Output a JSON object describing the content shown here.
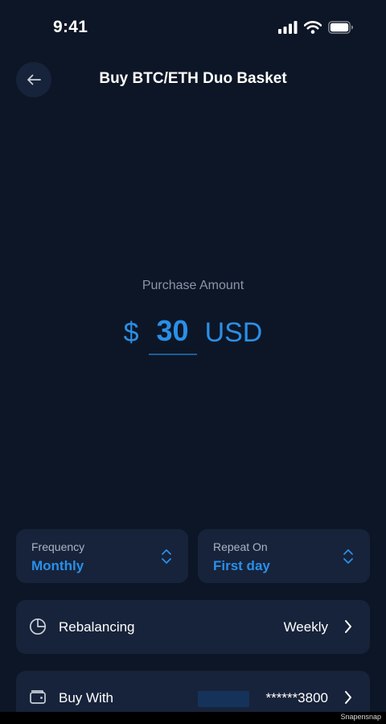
{
  "status_bar": {
    "time": "9:41",
    "icons": [
      "signal-icon",
      "wifi-icon",
      "battery-icon"
    ]
  },
  "header": {
    "back_icon": "arrow-left-icon",
    "title": "Buy BTC/ETH Duo Basket"
  },
  "purchase": {
    "label": "Purchase Amount",
    "currency_symbol": "$",
    "amount": "30",
    "currency_code": "USD"
  },
  "frequency": {
    "label": "Frequency",
    "value": "Monthly",
    "icon": "chevron-up-down-icon"
  },
  "repeat_on": {
    "label": "Repeat On",
    "value": "First day",
    "icon": "chevron-up-down-icon"
  },
  "rebalancing": {
    "icon": "pie-chart-icon",
    "label": "Rebalancing",
    "value": "Weekly"
  },
  "buy_with": {
    "icon": "wallet-icon",
    "label": "Buy With",
    "value": "******3800"
  },
  "watermark": "Snapensnap",
  "colors": {
    "background": "#0d1626",
    "card": "#17233a",
    "accent": "#2a8fe8",
    "muted_text": "#8a95aa"
  }
}
